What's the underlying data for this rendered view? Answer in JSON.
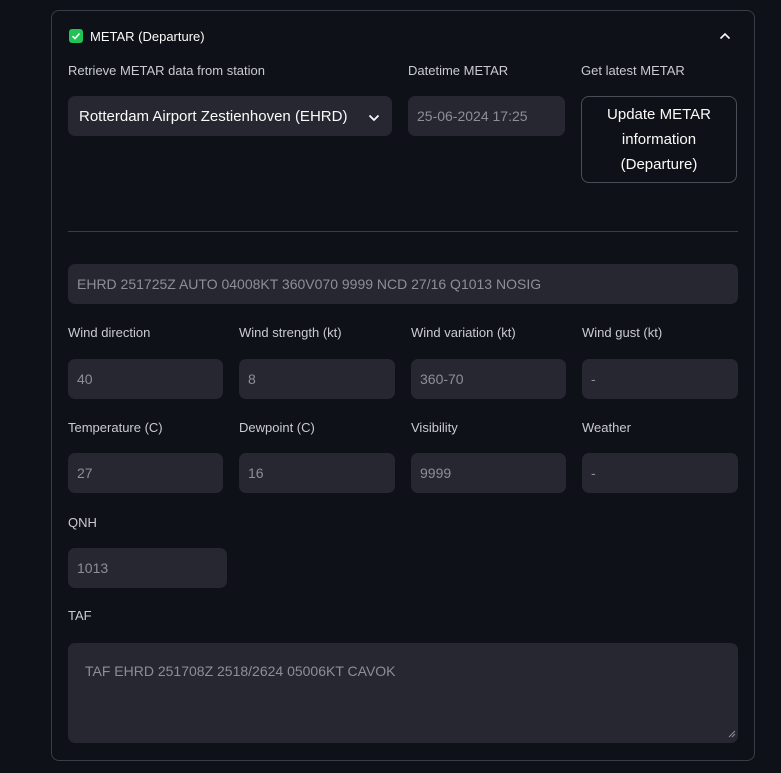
{
  "expander": {
    "title": "METAR (Departure)",
    "checked": true,
    "icon": "chevron-up-icon"
  },
  "station": {
    "label": "Retrieve METAR data from station",
    "value": "Rotterdam Airport Zestienhoven (EHRD)"
  },
  "datetime": {
    "label": "Datetime METAR",
    "value": "25-06-2024 17:25"
  },
  "update": {
    "label": "Get latest METAR",
    "button_line1": "Update METAR",
    "button_line2": "information",
    "button_line3": "(Departure)"
  },
  "metar_raw": "EHRD 251725Z AUTO 04008KT 360V070 9999 NCD 27/16 Q1013 NOSIG",
  "fields": {
    "wind_direction": {
      "label": "Wind direction",
      "value": "40"
    },
    "wind_strength": {
      "label": "Wind strength (kt)",
      "value": "8"
    },
    "wind_variation": {
      "label": "Wind variation (kt)",
      "value": "360-70"
    },
    "wind_gust": {
      "label": "Wind gust (kt)",
      "value": "-"
    },
    "temperature": {
      "label": "Temperature (C)",
      "value": "27"
    },
    "dewpoint": {
      "label": "Dewpoint (C)",
      "value": "16"
    },
    "visibility": {
      "label": "Visibility",
      "value": "9999"
    },
    "weather": {
      "label": "Weather",
      "value": "-"
    },
    "qnh": {
      "label": "QNH",
      "value": "1013"
    }
  },
  "taf": {
    "label": "TAF",
    "value": "TAF EHRD 251708Z 2518/2624 05006KT CAVOK"
  },
  "colors": {
    "background": "#0e1117",
    "input_bg": "#262730",
    "checkbox": "#21c354"
  }
}
